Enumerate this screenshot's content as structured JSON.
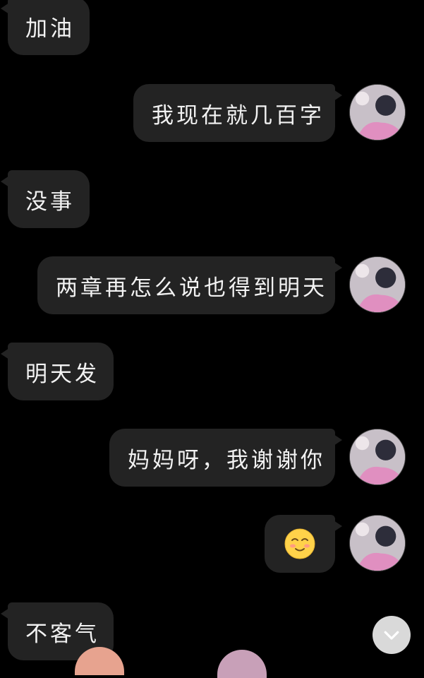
{
  "messages": [
    {
      "side": "left",
      "text": "加油"
    },
    {
      "side": "right",
      "text": "我现在就几百字"
    },
    {
      "side": "left",
      "text": "没事"
    },
    {
      "side": "right",
      "text": "两章再怎么说也得到明天"
    },
    {
      "side": "left",
      "text": "明天发"
    },
    {
      "side": "right",
      "text": "妈妈呀，我谢谢你"
    },
    {
      "side": "right",
      "text": "",
      "emoji": "blushing-smile-emoji"
    },
    {
      "side": "left",
      "text": "不客气"
    }
  ],
  "icons": {
    "scroll_down": "chevron-down-icon",
    "emoji": "blushing-smile-emoji"
  },
  "colors": {
    "background": "#000000",
    "bubble": "#232323",
    "text": "#f2f2f2",
    "scroll_button": "#d9d9d9"
  }
}
